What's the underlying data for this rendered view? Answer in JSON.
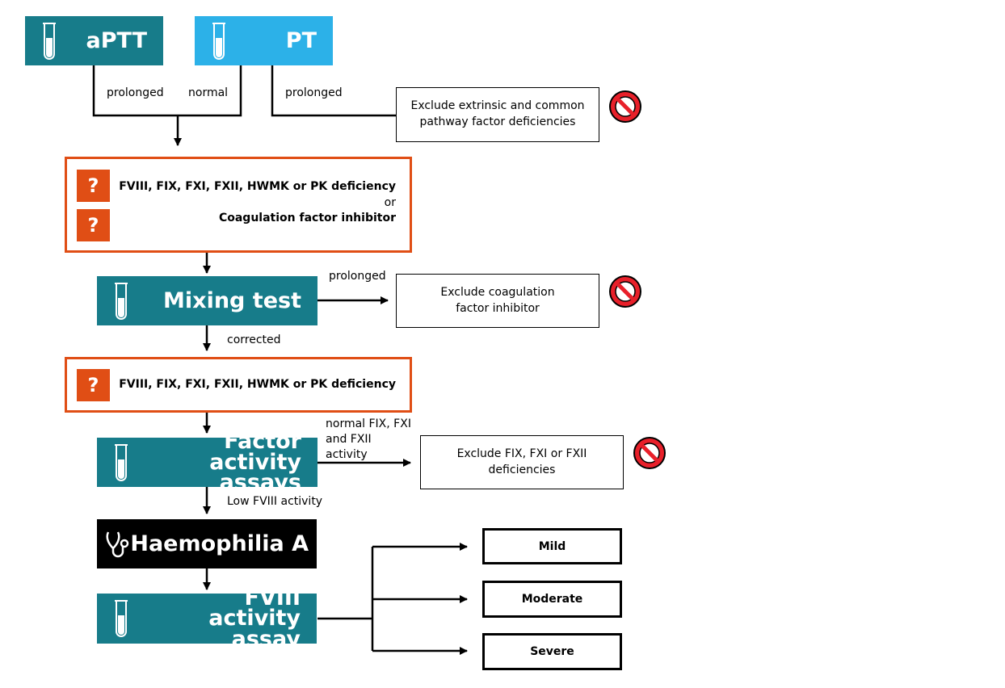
{
  "colors": {
    "teal": "#177c8a",
    "blue": "#2cb1e8",
    "orange": "#e04e15",
    "black": "#000000"
  },
  "tests": {
    "aptt": "aPTT",
    "pt": "PT",
    "mixing": "Mixing test",
    "factor": "Factor activity assays",
    "fviii": "FVIII activity assay"
  },
  "labels": {
    "aptt_prolonged": "prolonged",
    "pt_normal": "normal",
    "pt_prolonged": "prolonged",
    "mix_prolonged": "prolonged",
    "corrected": "corrected",
    "normal_factors": "normal FIX, FXI and FXII activity",
    "low_fviii": "Low FVIII activity"
  },
  "exclusions": {
    "extrinsic": "Exclude extrinsic and common pathway factor deficiencies",
    "inhibitor": "Exclude coagulation factor inhibitor",
    "factors": "Exclude FIX, FXI or FXII deficiencies"
  },
  "hypothesis1": {
    "line1": "FVIII, FIX, FXI, FXII, HWMK or PK deficiency",
    "or": "or",
    "line2": "Coagulation factor inhibitor"
  },
  "hypothesis2": {
    "line1": "FVIII, FIX, FXI, FXII, HWMK or PK deficiency"
  },
  "question_mark": "?",
  "diagnosis": "Haemophilia A",
  "severity": [
    "Mild",
    "Moderate",
    "Severe"
  ],
  "icons": {
    "test": "test-tube-icon",
    "question": "question-mark-icon",
    "exclude": "no-entry-icon",
    "diagnosis": "stethoscope-icon"
  }
}
